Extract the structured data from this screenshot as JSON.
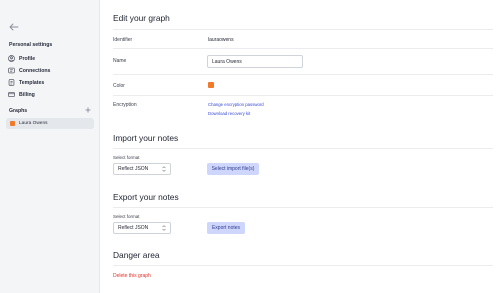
{
  "sidebar": {
    "back_icon": "arrow-left-icon",
    "personal_heading": "Personal settings",
    "items": [
      {
        "label": "Profile",
        "icon": "user-circle-icon"
      },
      {
        "label": "Connections",
        "icon": "connections-icon"
      },
      {
        "label": "Templates",
        "icon": "template-icon"
      },
      {
        "label": "Billing",
        "icon": "credit-card-icon"
      }
    ],
    "graphs_heading": "Graphs",
    "add_icon": "plus-icon",
    "graphs": [
      {
        "label": "Laura Owens",
        "color": "#f07a2a"
      }
    ]
  },
  "edit": {
    "title": "Edit your graph",
    "identifier_label": "Identifier",
    "identifier_value": "lauraowens",
    "name_label": "Name",
    "name_value": "Laura Owens",
    "color_label": "Color",
    "color_value": "#f07a2a",
    "encryption_label": "Encryption",
    "change_password_link": "Change encryption password",
    "download_kit_link": "Download recovery kit"
  },
  "import": {
    "title": "Import your notes",
    "format_label": "Select format",
    "format_value": "Reflect JSON",
    "button_label": "Select import file(s)"
  },
  "export": {
    "title": "Export your notes",
    "format_label": "Select format",
    "format_value": "Reflect JSON",
    "button_label": "Export notes"
  },
  "danger": {
    "title": "Danger area",
    "delete_link": "Delete this graph"
  },
  "colors": {
    "accent": "#3548d4",
    "button_bg": "#cfd6fb",
    "danger": "#e0312a",
    "graph_color": "#f07a2a"
  }
}
